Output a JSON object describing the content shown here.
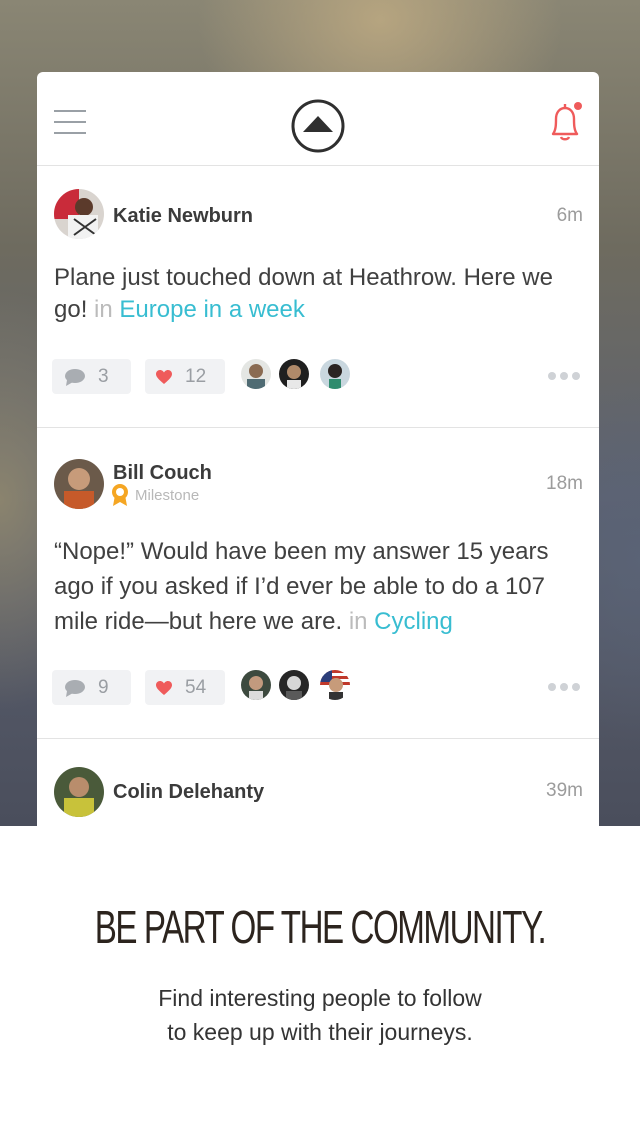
{
  "header": {
    "menu_icon": "hamburger-icon",
    "logo_icon": "mountain-logo-icon",
    "notification_icon": "bell-icon",
    "accent": "#ef5b5b"
  },
  "posts": [
    {
      "author": "Katie Newburn",
      "time": "6m",
      "text": "Plane just touched down at Heathrow. Here we go!",
      "in_word": "in",
      "tag": "Europe in a week",
      "comments": "3",
      "likes": "12"
    },
    {
      "author": "Bill Couch",
      "badge": "Milestone",
      "time": "18m",
      "text": "“Nope!” Would have been my answer 15 years ago if you asked if I’d ever be able to do a 107 mile ride—but here we are.",
      "in_word": "in",
      "tag": "Cycling",
      "comments": "9",
      "likes": "54"
    },
    {
      "author": "Colin Delehanty",
      "time": "39m"
    }
  ],
  "promo": {
    "headline": "BE PART OF THE COMMUNITY.",
    "line1": "Find interesting people to follow",
    "line2": "to keep up with their journeys."
  },
  "colors": {
    "tag": "#38bdd1",
    "like": "#ef5b5b",
    "milestone": "#f5a623"
  }
}
